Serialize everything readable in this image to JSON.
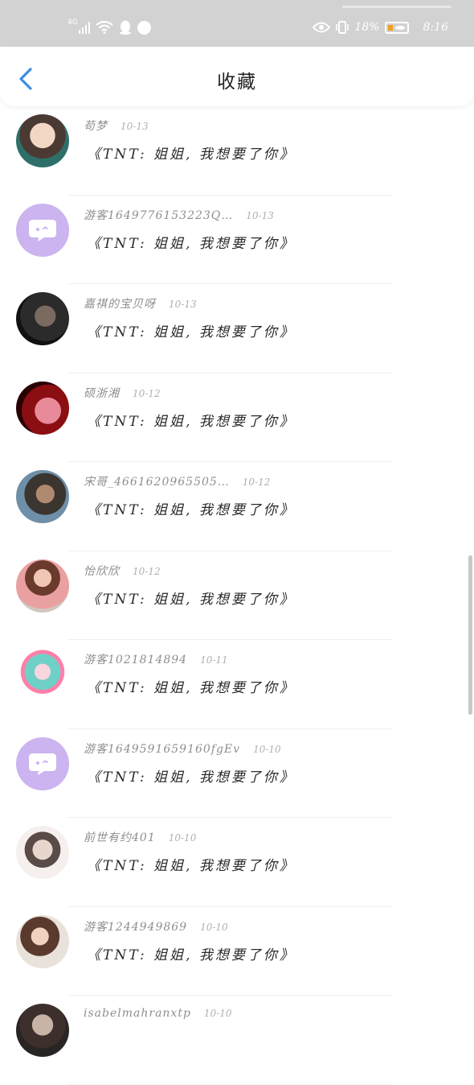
{
  "status_bar": {
    "network": "4G",
    "battery_text": "18%",
    "time": "8:16",
    "left_icons": [
      "signal-icon",
      "wifi-icon",
      "qq-icon",
      "app-icon"
    ],
    "right_icons": [
      "eye-icon",
      "vibrate-icon",
      "battery-icon"
    ]
  },
  "header": {
    "title": "收藏",
    "back_icon": "chevron-left-icon"
  },
  "colors": {
    "accent": "#3a8ee6",
    "guest_avatar": "#cbb4ef",
    "status_bar": "#d2d2d2",
    "battery_fill": "#f0a020"
  },
  "items": [
    {
      "name": "苟梦",
      "date": "10-13",
      "message": "《TNT: 姐姐, 我想要了你》",
      "avatar": "anime-girl"
    },
    {
      "name": "游客1649776153223Q…",
      "date": "10-13",
      "message": "《TNT: 姐姐, 我想要了你》",
      "avatar": "guest"
    },
    {
      "name": "嘉祺的宝贝呀",
      "date": "10-13",
      "message": "《TNT: 姐姐, 我想要了你》",
      "avatar": "photo"
    },
    {
      "name": "硕浙湘",
      "date": "10-12",
      "message": "《TNT: 姐姐, 我想要了你》",
      "avatar": "photo"
    },
    {
      "name": "宋哥_4661620965505…",
      "date": "10-12",
      "message": "《TNT: 姐姐, 我想要了你》",
      "avatar": "photo"
    },
    {
      "name": "怡欣欣",
      "date": "10-12",
      "message": "《TNT: 姐姐, 我想要了你》",
      "avatar": "photo"
    },
    {
      "name": "游客1021814894",
      "date": "10-11",
      "message": "《TNT: 姐姐, 我想要了你》",
      "avatar": "cartoon"
    },
    {
      "name": "游客1649591659160fgEv",
      "date": "10-10",
      "message": "《TNT: 姐姐, 我想要了你》",
      "avatar": "guest"
    },
    {
      "name": "前世有约401",
      "date": "10-10",
      "message": "《TNT: 姐姐, 我想要了你》",
      "avatar": "photo"
    },
    {
      "name": "游客1244949869",
      "date": "10-10",
      "message": "《TNT: 姐姐, 我想要了你》",
      "avatar": "photo"
    },
    {
      "name": "isabelmahranxtp",
      "date": "10-10",
      "message": "",
      "avatar": "photo"
    }
  ]
}
